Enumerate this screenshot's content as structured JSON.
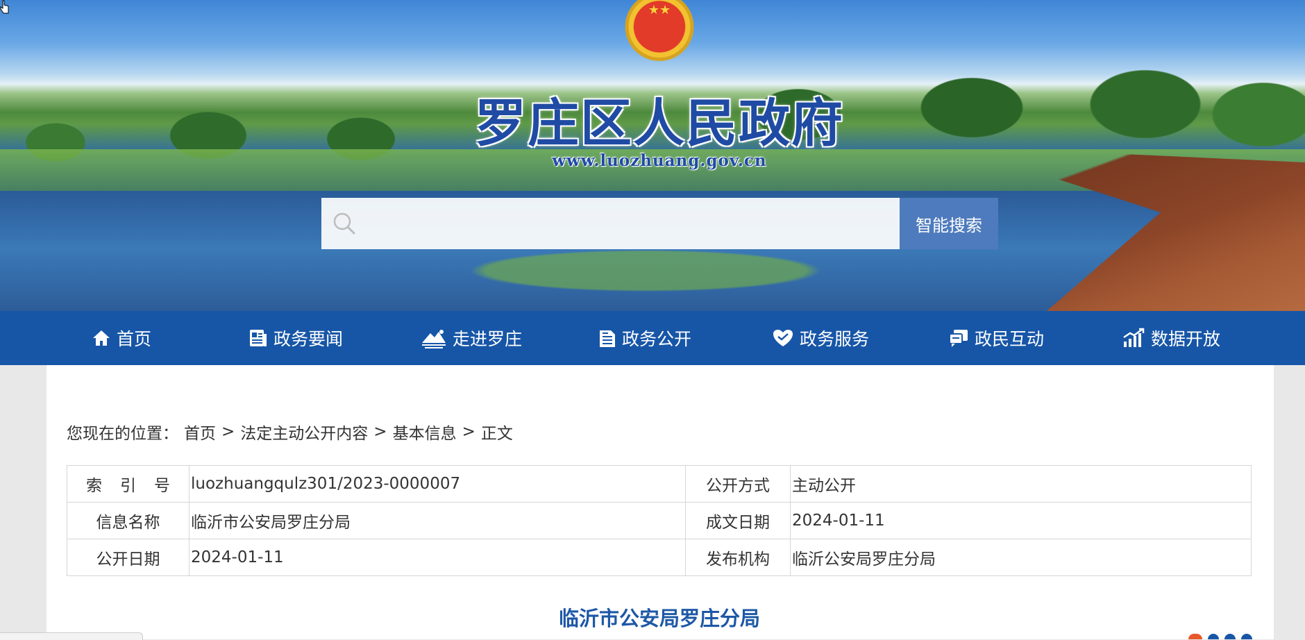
{
  "header": {
    "site_title": "罗庄区人民政府",
    "site_url": "www.luozhuang.gov.cn",
    "emblem_stars": "★★"
  },
  "search": {
    "placeholder": "",
    "button_label": "智能搜索"
  },
  "nav": {
    "items": [
      {
        "label": "首页",
        "icon": "home-icon"
      },
      {
        "label": "政务要闻",
        "icon": "news-icon"
      },
      {
        "label": "走进罗庄",
        "icon": "landscape-icon"
      },
      {
        "label": "政务公开",
        "icon": "document-icon"
      },
      {
        "label": "政务服务",
        "icon": "heart-icon"
      },
      {
        "label": "政民互动",
        "icon": "chat-icon"
      },
      {
        "label": "数据开放",
        "icon": "chart-icon"
      }
    ]
  },
  "breadcrumb": {
    "prefix": "您现在的位置：",
    "items": [
      "首页",
      "法定主动公开内容",
      "基本信息",
      "正文"
    ],
    "separator": ">"
  },
  "meta": {
    "index_label": "索引号",
    "index_value": "luozhuangqulz301/2023-0000007",
    "open_method_label": "公开方式",
    "open_method_value": "主动公开",
    "info_name_label": "信息名称",
    "info_name_value": "临沂市公安局罗庄分局",
    "written_date_label": "成文日期",
    "written_date_value": "2024-01-11",
    "open_date_label": "公开日期",
    "open_date_value": "2024-01-11",
    "publisher_label": "发布机构",
    "publisher_value": "临沂公安局罗庄分局"
  },
  "document": {
    "title": "临沂市公安局罗庄分局"
  },
  "colors": {
    "nav_bg": "#1756a7",
    "search_button": "#4e7bbd",
    "title_blue": "#1d58a6"
  }
}
